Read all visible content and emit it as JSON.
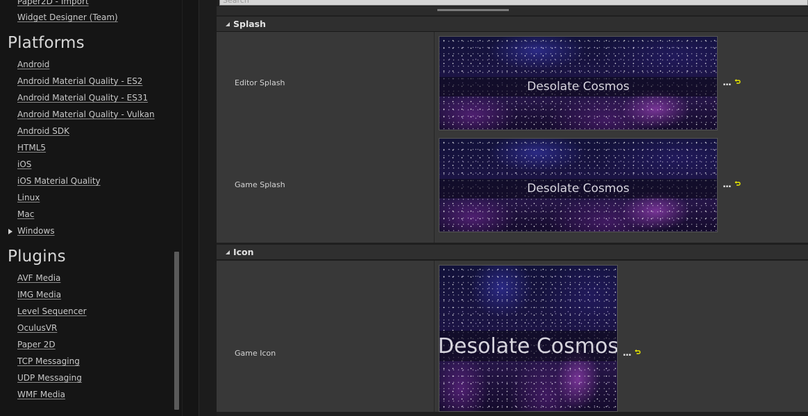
{
  "sidebar": {
    "top_links": [
      "Paper2D - Import",
      "Widget Designer (Team)"
    ],
    "platforms": {
      "heading": "Platforms",
      "items": [
        "Android",
        "Android Material Quality - ES2",
        "Android Material Quality - ES31",
        "Android Material Quality - Vulkan",
        "Android SDK",
        "HTML5",
        "iOS",
        "iOS Material Quality",
        "Linux",
        "Mac",
        "Windows"
      ]
    },
    "plugins": {
      "heading": "Plugins",
      "items": [
        "AVF Media",
        "IMG Media",
        "Level Sequencer",
        "OculusVR",
        "Paper 2D",
        "TCP Messaging",
        "UDP Messaging",
        "WMF Media"
      ]
    }
  },
  "search": {
    "placeholder": "Search"
  },
  "categories": {
    "splash": {
      "label": "Splash",
      "rows": [
        {
          "name": "Editor Splash",
          "image_text": "Desolate Cosmos"
        },
        {
          "name": "Game Splash",
          "image_text": "Desolate Cosmos"
        }
      ]
    },
    "icon": {
      "label": "Icon",
      "rows": [
        {
          "name": "Game Icon",
          "image_text": "Desolate Cosmos"
        }
      ]
    }
  },
  "controls": {
    "browse_label": "...",
    "reset_icon": "reset-to-default-arrow-icon"
  },
  "colors": {
    "reset_icon": "#e8e800",
    "panel_bg": "#383838",
    "sidebar_bg": "#151515"
  }
}
